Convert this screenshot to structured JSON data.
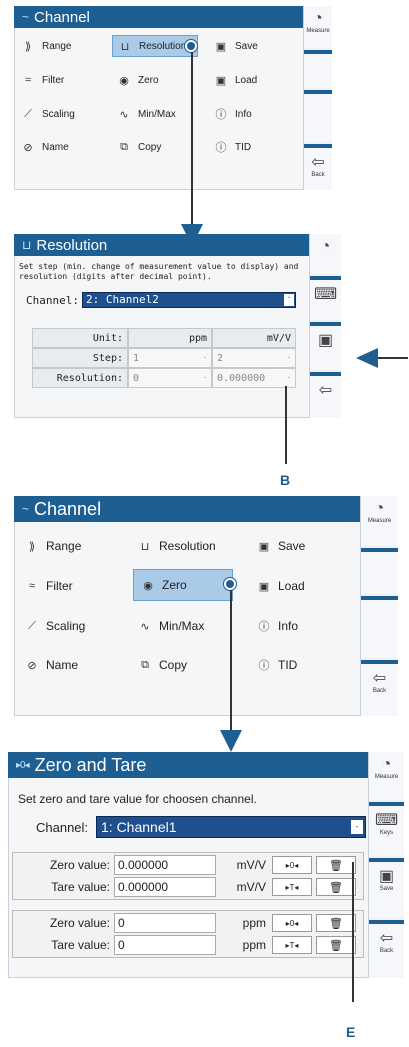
{
  "panel1": {
    "title": "Channel",
    "items": [
      {
        "label": "Range",
        "icon": "range-icon"
      },
      {
        "label": "Resolution",
        "icon": "resolution-icon"
      },
      {
        "label": "Save",
        "icon": "save-icon"
      },
      {
        "label": "Filter",
        "icon": "filter-icon"
      },
      {
        "label": "Zero",
        "icon": "zero-icon"
      },
      {
        "label": "Load",
        "icon": "load-icon"
      },
      {
        "label": "Scaling",
        "icon": "scaling-icon"
      },
      {
        "label": "Min/Max",
        "icon": "minmax-icon"
      },
      {
        "label": "Info",
        "icon": "info-icon"
      },
      {
        "label": "Name",
        "icon": "name-icon"
      },
      {
        "label": "Copy",
        "icon": "copy-icon"
      },
      {
        "label": "TID",
        "icon": "tid-icon"
      }
    ],
    "sidebar": {
      "measure": "Measure",
      "back": "Back"
    }
  },
  "panel2": {
    "title": "Resolution",
    "desc": "Set step (min. change of measurement value to display) and resolution (digits after decimal point).",
    "channel_label": "Channel:",
    "channel_value": "2: Channel2",
    "unit_label": "Unit:",
    "unit1": "ppm",
    "unit2": "mV/V",
    "step_label": "Step:",
    "step1": "1",
    "step2": "2",
    "res_label": "Resolution:",
    "res1": "0",
    "res2": "0.000000"
  },
  "label_b": "B",
  "panel3": {
    "title": "Channel",
    "items": [
      {
        "label": "Range"
      },
      {
        "label": "Resolution"
      },
      {
        "label": "Save"
      },
      {
        "label": "Filter"
      },
      {
        "label": "Zero"
      },
      {
        "label": "Load"
      },
      {
        "label": "Scaling"
      },
      {
        "label": "Min/Max"
      },
      {
        "label": "Info"
      },
      {
        "label": "Name"
      },
      {
        "label": "Copy"
      },
      {
        "label": "TID"
      }
    ],
    "sidebar": {
      "measure": "Measure",
      "back": "Back"
    }
  },
  "panel4": {
    "title": "Zero and Tare",
    "desc": "Set zero and tare value for choosen channel.",
    "channel_label": "Channel:",
    "channel_value": "1: Channel1",
    "rows": [
      {
        "label": "Zero value:",
        "value": "0.000000",
        "unit": "mV/V",
        "btn": "▸0◂"
      },
      {
        "label": "Tare value:",
        "value": "0.000000",
        "unit": "mV/V",
        "btn": "▸T◂"
      },
      {
        "label": "Zero value:",
        "value": "0",
        "unit": "ppm",
        "btn": "▸0◂"
      },
      {
        "label": "Tare value:",
        "value": "0",
        "unit": "ppm",
        "btn": "▸T◂"
      }
    ],
    "sidebar": {
      "measure": "Measure",
      "keys": "Keys",
      "save": "Save",
      "back": "Back"
    }
  },
  "label_e": "E"
}
